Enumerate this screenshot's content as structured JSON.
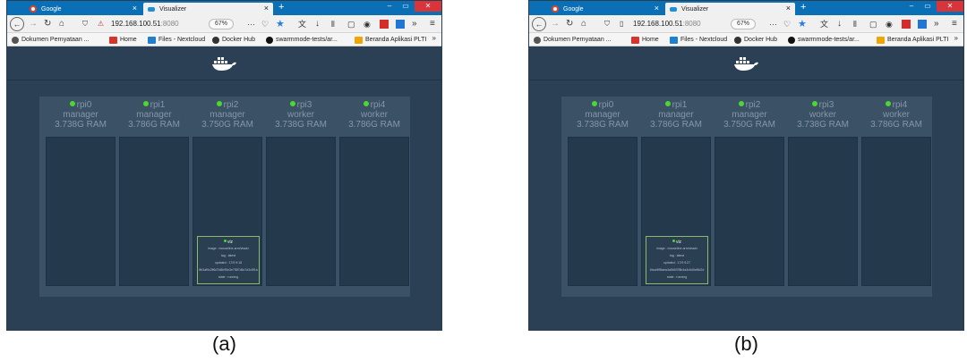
{
  "panels": [
    {
      "caption": "(a)",
      "tabs": [
        {
          "label": "Google"
        },
        {
          "label": "Visualizer"
        }
      ],
      "url_host": "192.168.100.51",
      "url_port": ":8080",
      "zoom": "67%",
      "bookmarks": [
        "Dokumen Pernyataan ...",
        "Home",
        "Files - Nextcloud",
        "Docker Hub",
        "swarmmode-tests/ar...",
        "Beranda Aplikasi PLTI"
      ],
      "nodes": [
        {
          "name": "rpi0",
          "role": "manager",
          "ram": "3.738G RAM"
        },
        {
          "name": "rpi1",
          "role": "manager",
          "ram": "3.786G RAM"
        },
        {
          "name": "rpi2",
          "role": "manager",
          "ram": "3.750G RAM"
        },
        {
          "name": "rpi3",
          "role": "worker",
          "ram": "3.738G RAM"
        },
        {
          "name": "rpi4",
          "role": "worker",
          "ram": "3.786G RAM"
        }
      ],
      "task": {
        "node_index": 2,
        "name": "viz",
        "image": "image : mouseline-arm/viswiz",
        "tag": "tag : latest",
        "updated": "updated : 17/9 9:18",
        "id": "8b3af9c2ff6d7d8b95e3e7f8f7d6c7d3c5f1a",
        "state": "state : running"
      }
    },
    {
      "caption": "(b)",
      "tabs": [
        {
          "label": "Google"
        },
        {
          "label": "Visualizer"
        }
      ],
      "url_host": "192.168.100.51",
      "url_port": ":8080",
      "zoom": "67%",
      "bookmarks": [
        "Dokumen Pernyataan ...",
        "Home",
        "Files - Nextcloud",
        "Docker Hub",
        "swarmmode-tests/ar...",
        "Beranda Aplikasi PLTI"
      ],
      "nodes": [
        {
          "name": "rpi0",
          "role": "manager",
          "ram": "3.738G RAM"
        },
        {
          "name": "rpi1",
          "role": "manager",
          "ram": "3.786G RAM"
        },
        {
          "name": "rpi2",
          "role": "manager",
          "ram": "3.750G RAM"
        },
        {
          "name": "rpi3",
          "role": "worker",
          "ram": "3.738G RAM"
        },
        {
          "name": "rpi4",
          "role": "worker",
          "ram": "3.786G RAM"
        }
      ],
      "task": {
        "node_index": 1,
        "name": "viz",
        "image": "image : mouseline-arm/viswiz",
        "tag": "tag : latest",
        "updated": "updated : 17/9 9:27",
        "id": "4bca9ff8aea4a8b5f7f8b4a3c6d0cf6b2d",
        "state": "state : running"
      }
    }
  ],
  "colors": {
    "page_bg": "#2b4055",
    "node_column": "#25394d",
    "node_status_dot": "#4bd82f",
    "task_border": "#8db86a",
    "tab_strip": "#0a6fb5"
  }
}
